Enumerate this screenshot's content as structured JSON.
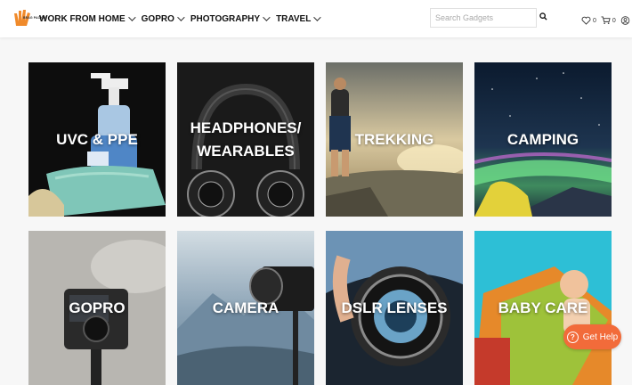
{
  "brand": {
    "logo_text": "BRAG PACKER"
  },
  "nav": [
    {
      "label": "WORK FROM HOME"
    },
    {
      "label": "GOPRO"
    },
    {
      "label": "PHOTOGRAPHY"
    },
    {
      "label": "TRAVEL"
    }
  ],
  "search": {
    "placeholder": "Search Gadgets",
    "value": ""
  },
  "header_icons": {
    "wishlist_count": "0",
    "cart_count": "0"
  },
  "categories": [
    {
      "label": "UVC & PPE"
    },
    {
      "label": "HEADPHONES/ WEARABLES"
    },
    {
      "label": "TREKKING"
    },
    {
      "label": "CAMPING"
    },
    {
      "label": "GOPRO"
    },
    {
      "label": "CAMERA"
    },
    {
      "label": "DSLR LENSES"
    },
    {
      "label": "BABY CARE"
    }
  ],
  "help_button": {
    "label": "Get Help"
  },
  "colors": {
    "accent": "#f26b3a",
    "header_bg": "#ffffff",
    "page_bg": "#f7f7f7"
  }
}
